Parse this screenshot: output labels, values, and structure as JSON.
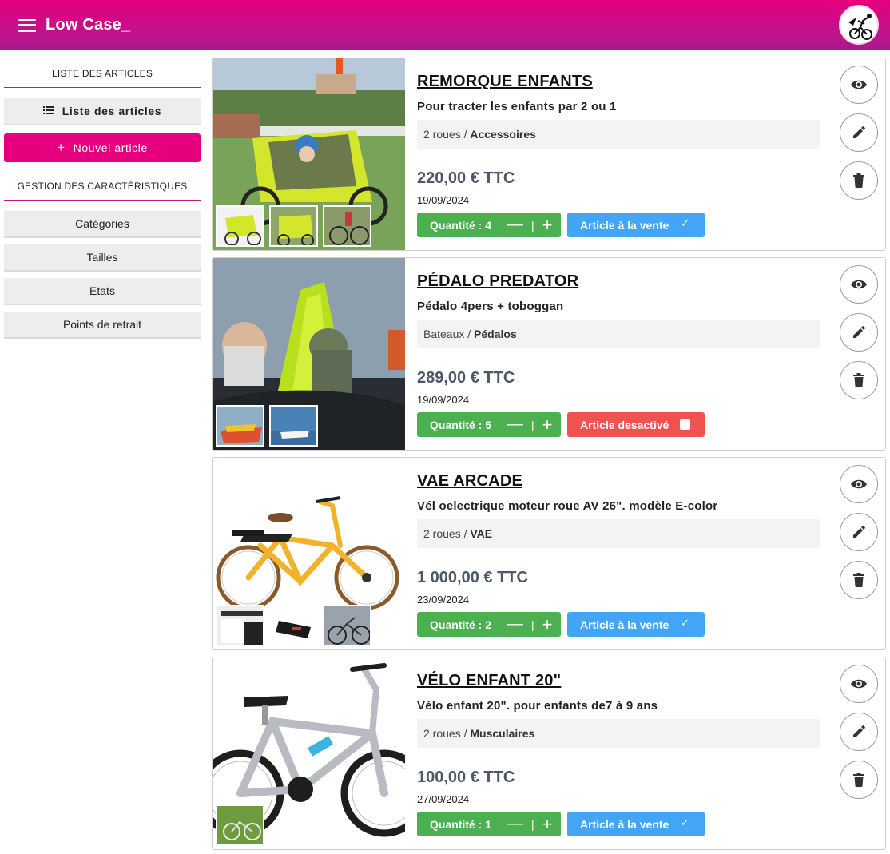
{
  "app": {
    "title": "Low Case_"
  },
  "sidebar": {
    "section1": "LISTE DES ARTICLES",
    "list_btn": "Liste des articles",
    "new_btn": "Nouvel article",
    "section2": "GESTION DES CARACTÉRISTIQUES",
    "items": [
      "Catégories",
      "Tailles",
      "Etats",
      "Points de retrait"
    ]
  },
  "articles": [
    {
      "title": "REMORQUE ENFANTS",
      "subtitle": "Pour tracter les enfants par 2 ou 1",
      "category": "2 roues",
      "subcategory": "Accessoires",
      "price": "220,00 € TTC",
      "date": "19/09/2024",
      "quantity": "Quantité : 4",
      "status": "Article à la vente"
    },
    {
      "title": "PÉDALO PREDATOR",
      "subtitle": "Pédalo 4pers + toboggan",
      "category": "Bateaux",
      "subcategory": "Pédalos",
      "price": "289,00 € TTC",
      "date": "19/09/2024",
      "quantity": "Quantité : 5",
      "status": "Article desactivé"
    },
    {
      "title": "VAE ARCADE",
      "subtitle": "Vél oelectrique moteur roue AV 26\". modèle E-color",
      "category": "2 roues",
      "subcategory": "VAE",
      "price": "1 000,00 € TTC",
      "date": "23/09/2024",
      "quantity": "Quantité : 2",
      "status": "Article à la vente"
    },
    {
      "title": "VÉLO ENFANT 20\"",
      "subtitle": "Vélo enfant 20\". pour enfants de7 à 9 ans",
      "category": "2 roues",
      "subcategory": "Musculaires",
      "price": "100,00 € TTC",
      "date": "27/09/2024",
      "quantity": "Quantité : 1",
      "status": "Article à la vente"
    }
  ],
  "common": {
    "slash": " / ",
    "minus": "—",
    "sep": "|",
    "plus": "+"
  },
  "icons": {
    "view": "eye-icon",
    "edit": "pencil-icon",
    "delete": "trash-icon",
    "menu": "hamburger-icon",
    "list": "list-icon",
    "add": "plus-icon"
  },
  "colors": {
    "brand": "#e6007e",
    "qty": "#4caf50",
    "on_sale": "#42a5f5",
    "disabled": "#ef5350",
    "price": "#4c5768"
  }
}
